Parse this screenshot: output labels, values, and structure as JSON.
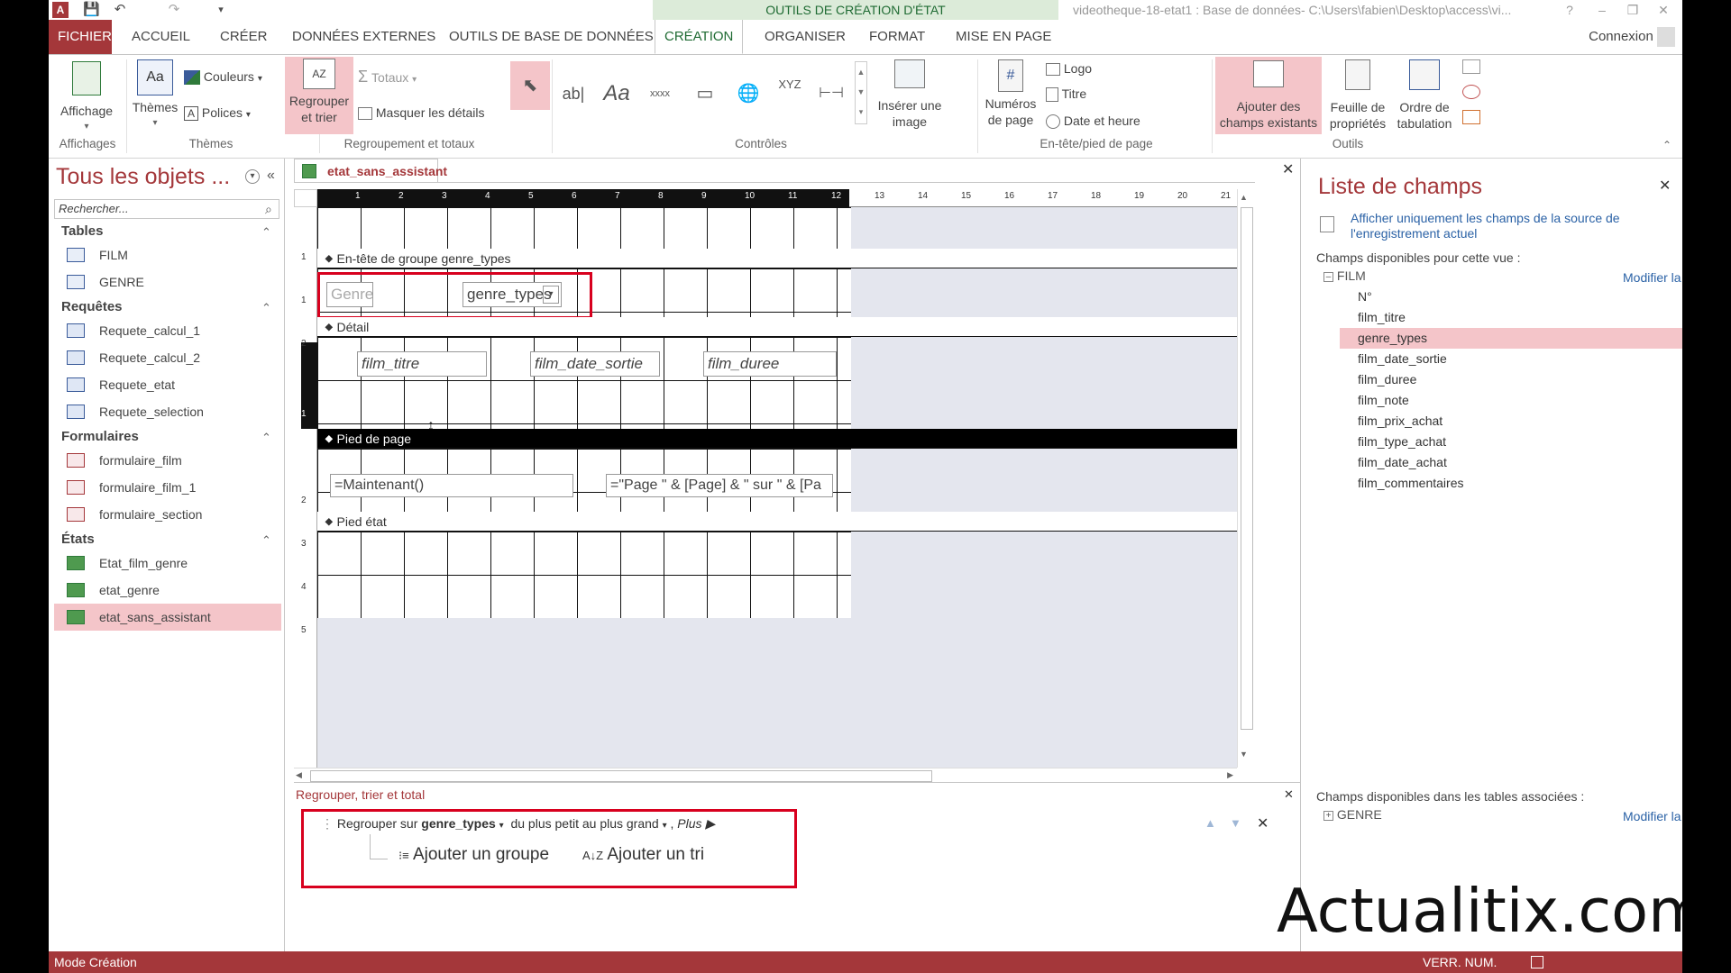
{
  "window": {
    "context_band": "OUTILS DE CRÉATION D'ÉTAT",
    "title": "videotheque-18-etat1 : Base de données- C:\\Users\\fabien\\Desktop\\access\\vi...",
    "help": "?",
    "minimize": "–",
    "restore": "❐",
    "close": "✕"
  },
  "qat": {
    "app_icon": "A",
    "save_icon": "💾",
    "undo_icon": "↶",
    "redo_icon": "↷",
    "more_icon": "▾"
  },
  "tabs": {
    "file": "FICHIER",
    "accueil": "ACCUEIL",
    "creer": "CRÉER",
    "donnees_externes": "DONNÉES EXTERNES",
    "outils_bdd": "OUTILS DE BASE DE DONNÉES",
    "creation": "CRÉATION",
    "organiser": "ORGANISER",
    "format": "FORMAT",
    "mise_en_page": "MISE EN PAGE",
    "connexion": "Connexion"
  },
  "ribbon": {
    "affichage": "Affichage",
    "themes": "Thèmes",
    "couleurs": "Couleurs",
    "polices": "Polices",
    "regrouper_line1": "Regrouper",
    "regrouper_line2": "et trier",
    "totaux": "Totaux",
    "masquer": "Masquer les détails",
    "inserer_line1": "Insérer une",
    "inserer_line2": "image",
    "numeros_line1": "Numéros",
    "numeros_line2": "de page",
    "logo": "Logo",
    "titre": "Titre",
    "date_heure": "Date et heure",
    "ajouter_line1": "Ajouter des",
    "ajouter_line2": "champs existants",
    "feuille_line1": "Feuille de",
    "feuille_line2": "propriétés",
    "ordre_line1": "Ordre de",
    "ordre_line2": "tabulation",
    "groups": {
      "affichages": "Affichages",
      "themes": "Thèmes",
      "regroupement": "Regroupement et totaux",
      "controles": "Contrôles",
      "entete": "En-tête/pied de page",
      "outils": "Outils"
    },
    "controls": {
      "select": "⬉",
      "textbox": "ab|",
      "label": "Aa",
      "button": "xxxx",
      "tab": "▭",
      "hyperlink": "🌐",
      "navigation": "XYZ",
      "break": "⊢⊣"
    }
  },
  "nav": {
    "title": "Tous les objets ...",
    "search_placeholder": "Rechercher...",
    "sections": {
      "tables": "Tables",
      "requetes": "Requêtes",
      "formulaires": "Formulaires",
      "etats": "États"
    },
    "tables": [
      "FILM",
      "GENRE"
    ],
    "requetes": [
      "Requete_calcul_1",
      "Requete_calcul_2",
      "Requete_etat",
      "Requete_selection"
    ],
    "formulaires": [
      "formulaire_film",
      "formulaire_film_1",
      "formulaire_section"
    ],
    "etats": [
      "Etat_film_genre",
      "etat_genre",
      "etat_sans_assistant"
    ]
  },
  "document": {
    "tab_label": "etat_sans_assistant",
    "sections": {
      "group_header": "En-tête de groupe genre_types",
      "detail": "Détail",
      "page_footer": "Pied de page",
      "report_footer": "Pied état"
    },
    "controls": {
      "genre_label": "Genre",
      "genre_combo": "genre_types",
      "film_titre": "film_titre",
      "film_date_sortie": "film_date_sortie",
      "film_duree": "film_duree",
      "now": "=Maintenant()",
      "page_expr": "=\"Page \" & [Page] & \" sur \" & [Pa"
    },
    "ruler_h": [
      "1",
      "2",
      "3",
      "4",
      "5",
      "6",
      "7",
      "8",
      "9",
      "10",
      "11",
      "12",
      "13",
      "14",
      "15",
      "16",
      "17",
      "18",
      "19",
      "20",
      "21"
    ],
    "ruler_v": [
      "1",
      "1",
      "2",
      "1",
      "1",
      "2",
      "3",
      "4",
      "5"
    ]
  },
  "group_pane": {
    "title": "Regrouper, trier et total",
    "regrouper_sur": "Regrouper sur",
    "field": "genre_types",
    "order": "du plus petit au plus grand",
    "plus": "Plus ▶",
    "add_group": "Ajouter un groupe",
    "add_sort": "Ajouter un tri"
  },
  "field_list": {
    "title": "Liste de champs",
    "show_only": "Afficher uniquement les champs de la source de l'enregistrement actuel",
    "available": "Champs disponibles pour cette vue :",
    "table": "FILM",
    "modify": "Modifier la table",
    "fields": [
      "N°",
      "film_titre",
      "genre_types",
      "film_date_sortie",
      "film_duree",
      "film_note",
      "film_prix_achat",
      "film_type_achat",
      "film_date_achat",
      "film_commentaires"
    ],
    "related": "Champs disponibles dans les tables associées :",
    "related_table": "GENRE",
    "modify2": "Modifier la table"
  },
  "status": {
    "mode": "Mode Création",
    "verr_num": "VERR. NUM."
  },
  "watermark": "Actualitix.com",
  "colors": {
    "accent": "#a4373a",
    "highlight": "#f4c5c9",
    "context_green": "#1f6b33",
    "redbox": "#d8001e"
  }
}
